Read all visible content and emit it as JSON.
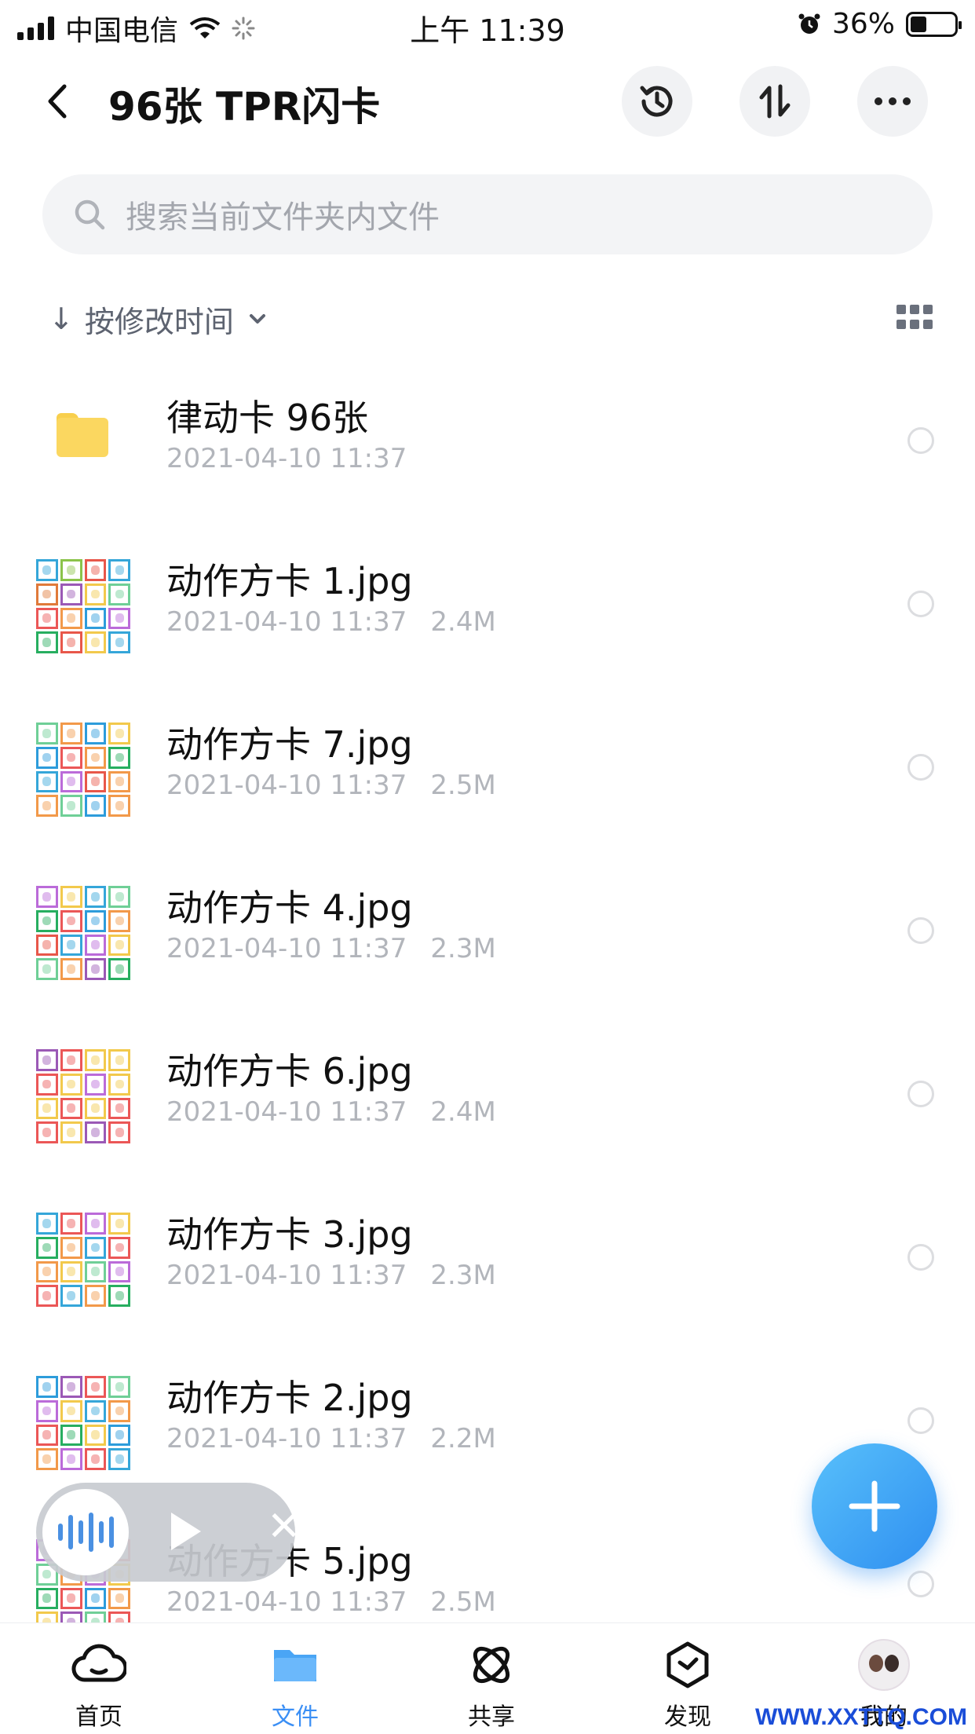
{
  "status_bar": {
    "carrier": "中国电信",
    "time": "上午 11:39",
    "battery": "36%"
  },
  "header": {
    "title": "96张 TPR闪卡"
  },
  "search": {
    "placeholder": "搜索当前文件夹内文件"
  },
  "sort": {
    "arrow": "↓",
    "label": "按修改时间"
  },
  "files": [
    {
      "name": "律动卡 96张",
      "date": "2021-04-10 11:37",
      "size": "",
      "type": "folder"
    },
    {
      "name": "动作方卡 1.jpg",
      "date": "2021-04-10 11:37",
      "size": "2.4M",
      "type": "image"
    },
    {
      "name": "动作方卡 7.jpg",
      "date": "2021-04-10 11:37",
      "size": "2.5M",
      "type": "image"
    },
    {
      "name": "动作方卡 4.jpg",
      "date": "2021-04-10 11:37",
      "size": "2.3M",
      "type": "image"
    },
    {
      "name": "动作方卡 6.jpg",
      "date": "2021-04-10 11:37",
      "size": "2.4M",
      "type": "image"
    },
    {
      "name": "动作方卡 3.jpg",
      "date": "2021-04-10 11:37",
      "size": "2.3M",
      "type": "image"
    },
    {
      "name": "动作方卡 2.jpg",
      "date": "2021-04-10 11:37",
      "size": "2.2M",
      "type": "image"
    },
    {
      "name": "动作方卡 5.jpg",
      "date": "2021-04-10 11:37",
      "size": "2.5M",
      "type": "image"
    }
  ],
  "tabbar": {
    "items": [
      {
        "label": "首页",
        "icon": "cloud-icon"
      },
      {
        "label": "文件",
        "icon": "folder-icon"
      },
      {
        "label": "共享",
        "icon": "share-icon"
      },
      {
        "label": "发现",
        "icon": "discover-icon"
      },
      {
        "label": "我的",
        "icon": "avatar"
      }
    ],
    "active_index": 1
  },
  "watermark": "WWW.XXTTQ.COM",
  "colors": {
    "accent": "#3b8ff5",
    "fab": "#3d9cf3",
    "folder": "#fbd760",
    "muted_text": "#b2b5bb"
  }
}
